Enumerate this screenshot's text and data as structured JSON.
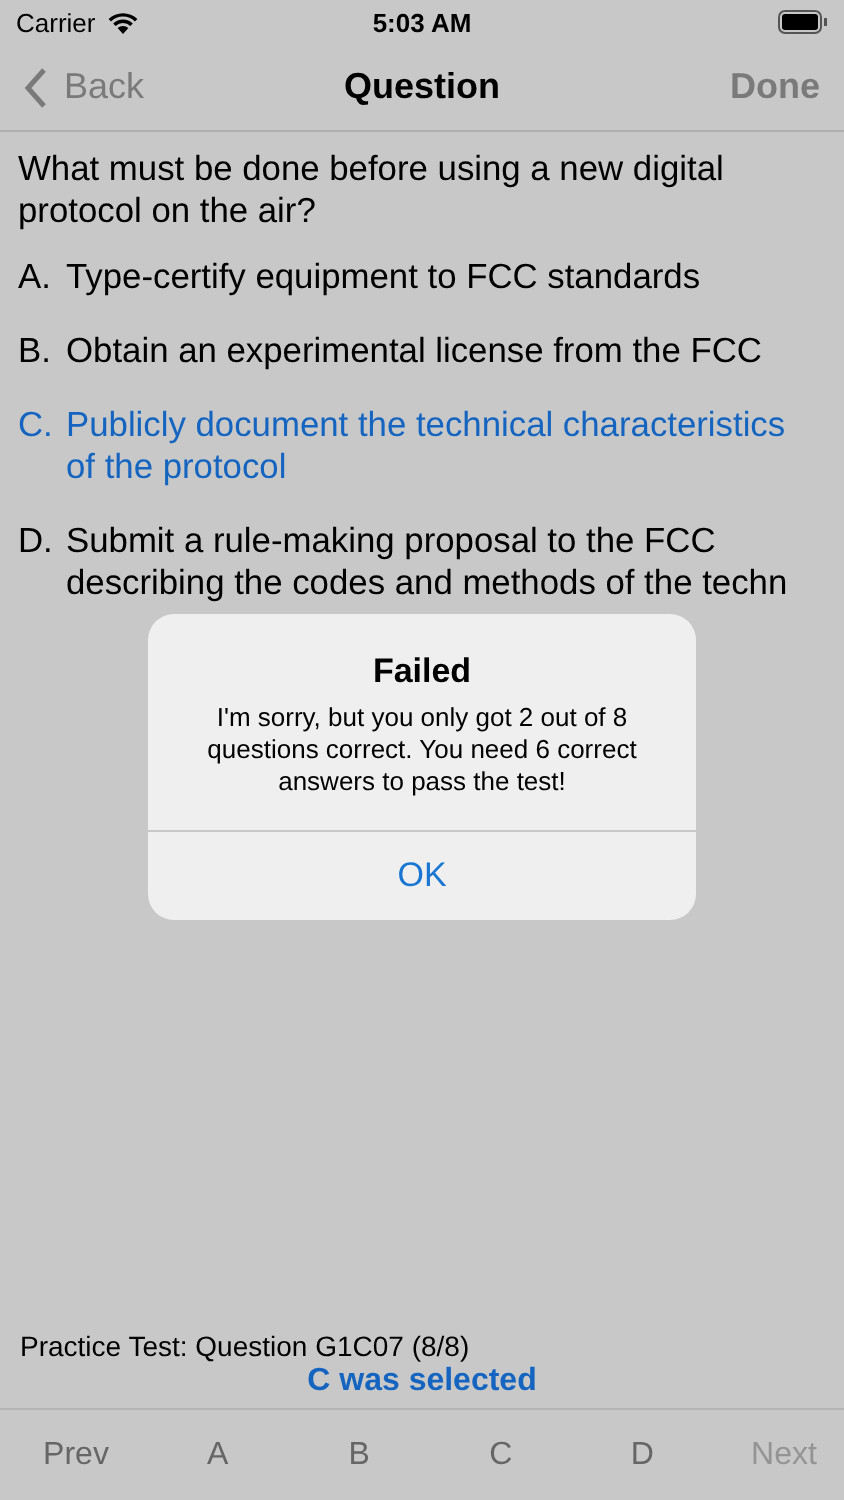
{
  "status_bar": {
    "carrier": "Carrier",
    "time": "5:03 AM"
  },
  "nav_bar": {
    "back": "Back",
    "title": "Question",
    "done": "Done"
  },
  "question": "What must be done before using a new digital protocol on the air?",
  "answers": [
    {
      "letter": "A.",
      "text": "Type-certify equipment to FCC standards",
      "selected": false
    },
    {
      "letter": "B.",
      "text": "Obtain an experimental license from the FCC",
      "selected": false
    },
    {
      "letter": "C.",
      "text": "Publicly document the technical characteristics of the protocol",
      "selected": true
    },
    {
      "letter": "D.",
      "text": "Submit a rule-making proposal to the FCC describing the codes and methods of the techn",
      "selected": false
    }
  ],
  "alert": {
    "title": "Failed",
    "message": "I'm sorry, but you only got 2 out of 8 questions correct.  You need 6 correct answers to pass the test!",
    "button": "OK"
  },
  "footer": {
    "info": "Practice Test:  Question G1C07 (8/8)",
    "selection": "C was selected"
  },
  "toolbar": [
    {
      "label": "Prev",
      "disabled": false
    },
    {
      "label": "A",
      "disabled": false
    },
    {
      "label": "B",
      "disabled": false
    },
    {
      "label": "C",
      "disabled": false
    },
    {
      "label": "D",
      "disabled": false
    },
    {
      "label": "Next",
      "disabled": true
    }
  ]
}
